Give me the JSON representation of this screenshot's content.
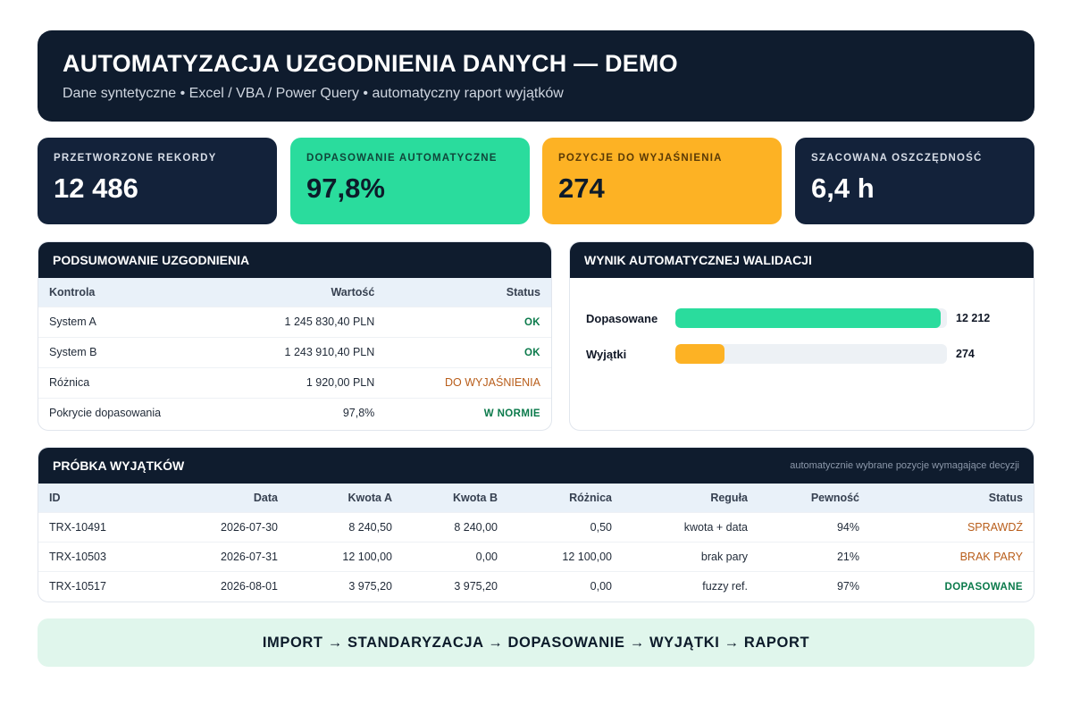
{
  "header": {
    "title": "AUTOMATYZACJA UZGODNIENIA DANYCH — DEMO",
    "subtitle": "Dane syntetyczne • Excel / VBA / Power Query • automatyczny raport wyjątków"
  },
  "kpis": [
    {
      "label": "PRZETWORZONE REKORDY",
      "value": "12 486",
      "color": "#13223a"
    },
    {
      "label": "DOPASOWANIE AUTOMATYCZNE",
      "value": "97,8%",
      "color": "#2adc9d"
    },
    {
      "label": "POZYCJE DO WYJAŚNIENIA",
      "value": "274",
      "color": "#fdb224"
    },
    {
      "label": "SZACOWANA OSZCZĘDNOŚĆ",
      "value": "6,4 h",
      "color": "#13223a"
    }
  ],
  "summary": {
    "title": "PODSUMOWANIE UZGODNIENIA",
    "columns": [
      "Kontrola",
      "Wartość",
      "Status"
    ],
    "rows": [
      {
        "control": "System A",
        "value": "1 245 830,40 PLN",
        "status": "OK"
      },
      {
        "control": "System B",
        "value": "1 243 910,40 PLN",
        "status": "OK"
      },
      {
        "control": "Różnica",
        "value": "1 920,00 PLN",
        "status": "DO WYJAŚNIENIA"
      },
      {
        "control": "Pokrycie dopasowania",
        "value": "97,8%",
        "status": "W NORMIE"
      }
    ]
  },
  "validation": {
    "title": "WYNIK AUTOMATYCZNEJ WALIDACJI",
    "bars": [
      {
        "label": "Dopasowane",
        "value": "12 212",
        "fraction": 0.978,
        "color": "#2adc9d"
      },
      {
        "label": "Wyjątki",
        "value": "274",
        "fraction": 0.18,
        "color": "#fdb224"
      }
    ]
  },
  "exceptions": {
    "title": "PRÓBKA WYJĄTKÓW",
    "note": "automatycznie wybrane pozycje wymagające decyzji",
    "columns": [
      "ID",
      "Data",
      "Kwota A",
      "Kwota B",
      "Różnica",
      "Reguła",
      "Pewność",
      "Status"
    ],
    "rows": [
      {
        "id": "TRX-10491",
        "date": "2026-07-30",
        "amount_a": "8 240,50",
        "amount_b": "8 240,00",
        "diff": "0,50",
        "rule": "kwota + data",
        "confidence": "94%",
        "status": "SPRAWDŹ"
      },
      {
        "id": "TRX-10503",
        "date": "2026-07-31",
        "amount_a": "12 100,00",
        "amount_b": "0,00",
        "diff": "12 100,00",
        "rule": "brak pary",
        "confidence": "21%",
        "status": "BRAK PARY"
      },
      {
        "id": "TRX-10517",
        "date": "2026-08-01",
        "amount_a": "3 975,20",
        "amount_b": "3 975,20",
        "diff": "0,00",
        "rule": "fuzzy ref.",
        "confidence": "97%",
        "status": "DOPASOWANE"
      }
    ]
  },
  "pipeline": "IMPORT → STANDARYZACJA → DOPASOWANIE → WYJĄTKI → RAPORT",
  "colors": {
    "ok": "#0b7a4b",
    "warn": "#b85d1a",
    "navy": "#0f1c2e"
  }
}
